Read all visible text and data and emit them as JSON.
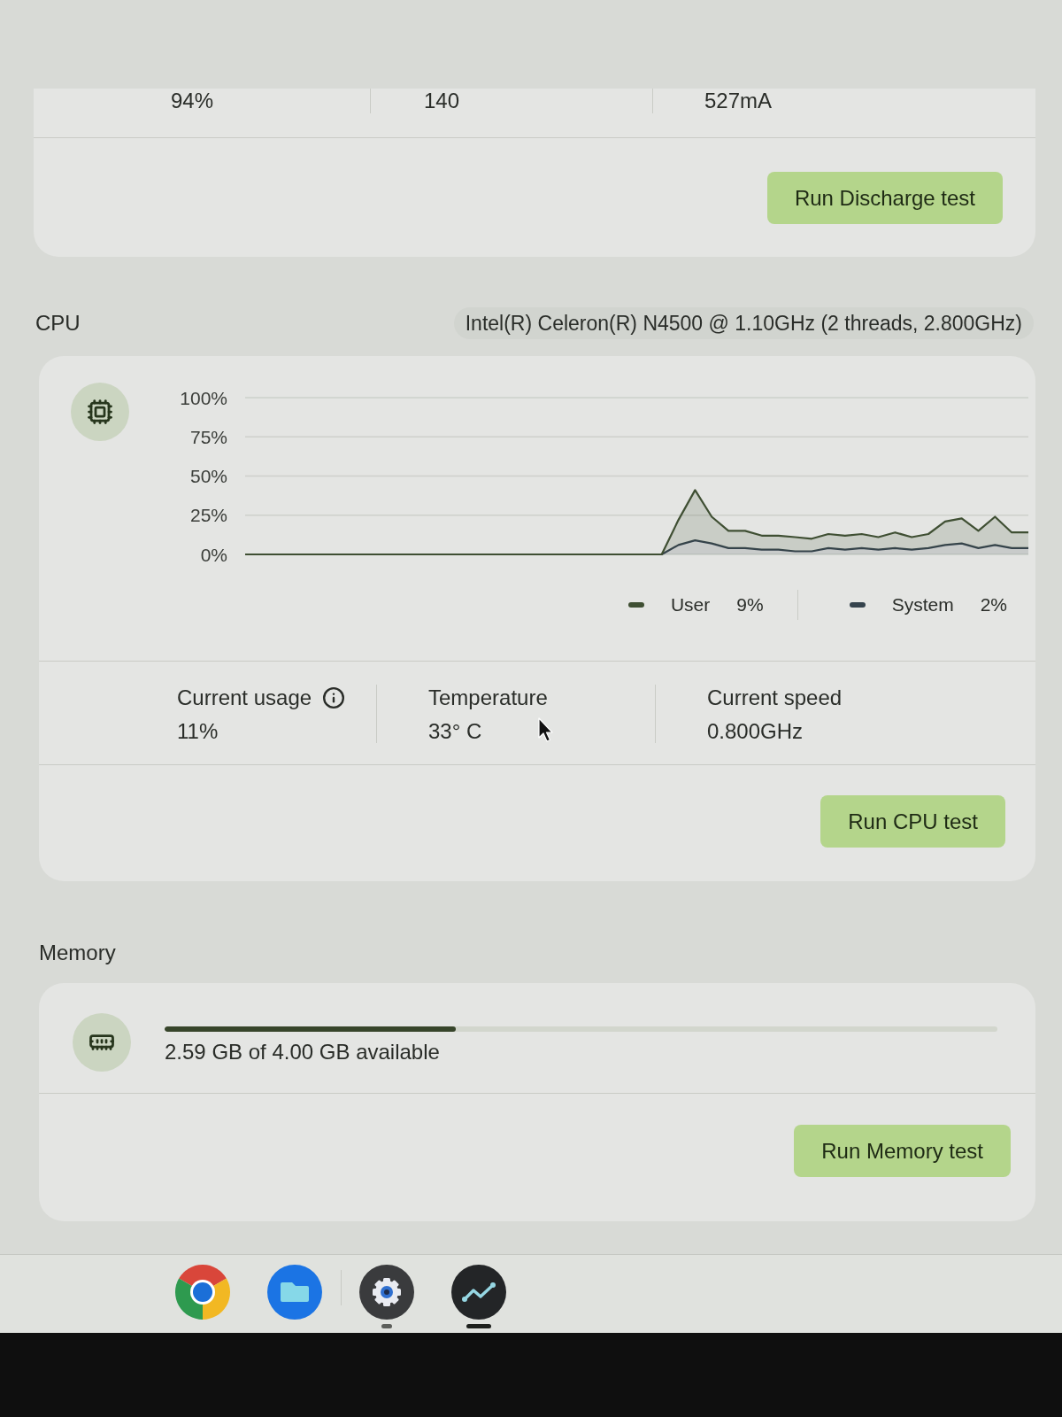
{
  "battery": {
    "readings": [
      {
        "value": "94%"
      },
      {
        "value": "140"
      },
      {
        "value": "527mA"
      }
    ],
    "button": "Run Discharge test"
  },
  "cpu": {
    "heading": "CPU",
    "model": "Intel(R) Celeron(R) N4500 @ 1.10GHz (2 threads, 2.800GHz)",
    "chart_data": {
      "type": "area",
      "stacked": true,
      "grid": true,
      "ylim": [
        0,
        100
      ],
      "yticks": [
        {
          "value": 0,
          "label": "0%"
        },
        {
          "value": 25,
          "label": "25%"
        },
        {
          "value": 50,
          "label": "50%"
        },
        {
          "value": 75,
          "label": "75%"
        },
        {
          "value": 100,
          "label": "100%"
        }
      ],
      "series": [
        {
          "name": "User",
          "color": "#3f4f33",
          "values": [
            0,
            0,
            0,
            0,
            0,
            0,
            0,
            0,
            0,
            0,
            0,
            0,
            0,
            0,
            0,
            0,
            0,
            0,
            0,
            0,
            0,
            0,
            0,
            0,
            0,
            0,
            16,
            32,
            17,
            11,
            11,
            9,
            9,
            9,
            8,
            9,
            9,
            9,
            8,
            10,
            8,
            9,
            15,
            16,
            11,
            18,
            10,
            10
          ]
        },
        {
          "name": "System",
          "color": "#35434d",
          "values": [
            0,
            0,
            0,
            0,
            0,
            0,
            0,
            0,
            0,
            0,
            0,
            0,
            0,
            0,
            0,
            0,
            0,
            0,
            0,
            0,
            0,
            0,
            0,
            0,
            0,
            0,
            6,
            9,
            7,
            4,
            4,
            3,
            3,
            2,
            2,
            4,
            3,
            4,
            3,
            4,
            3,
            4,
            6,
            7,
            4,
            6,
            4,
            4
          ]
        }
      ]
    },
    "legend": [
      {
        "value": "9%"
      },
      {
        "value": "2%"
      }
    ],
    "stats": [
      {
        "label": "Current usage",
        "value": "11%",
        "info": true
      },
      {
        "label": "Temperature",
        "value": "33° C",
        "info": false
      },
      {
        "label": "Current speed",
        "value": "0.800GHz",
        "info": false
      }
    ],
    "button": "Run CPU test"
  },
  "memory": {
    "heading": "Memory",
    "usage": {
      "level": 0.35,
      "text": "2.59 GB of 4.00 GB available"
    },
    "button": "Run Memory test"
  },
  "shelf": {
    "apps": [
      {
        "kind": "browser",
        "open": false,
        "active": false
      },
      {
        "kind": "files",
        "open": false,
        "active": false
      },
      {
        "kind": "settings",
        "open": true,
        "active": false
      },
      {
        "kind": "diagnostics",
        "open": true,
        "active": true
      }
    ]
  }
}
